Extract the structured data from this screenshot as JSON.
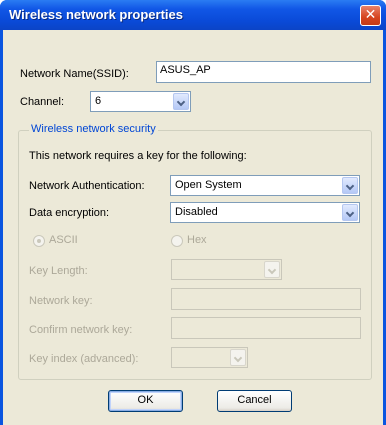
{
  "window": {
    "title": "Wireless network properties",
    "close_glyph": "✕"
  },
  "network_name": {
    "label": "Network Name(SSID):",
    "value": "ASUS_AP"
  },
  "channel": {
    "label": "Channel:",
    "value": "6"
  },
  "security": {
    "group_title": "Wireless network security",
    "description": "This network requires a key for the following:",
    "authentication": {
      "label": "Network Authentication:",
      "value": "Open System"
    },
    "encryption": {
      "label": "Data encryption:",
      "value": "Disabled"
    },
    "ascii_label": "ASCII",
    "hex_label": "Hex",
    "key_length_label": "Key Length:",
    "network_key_label": "Network key:",
    "confirm_key_label": "Confirm network key:",
    "key_index_label": "Key index (advanced):"
  },
  "buttons": {
    "ok": "OK",
    "cancel": "Cancel"
  },
  "colors": {
    "titlebar": "#0a4ad8",
    "dialog_bg": "#ece9d8",
    "group_title": "#0046d5",
    "close_button": "#d6451f"
  }
}
